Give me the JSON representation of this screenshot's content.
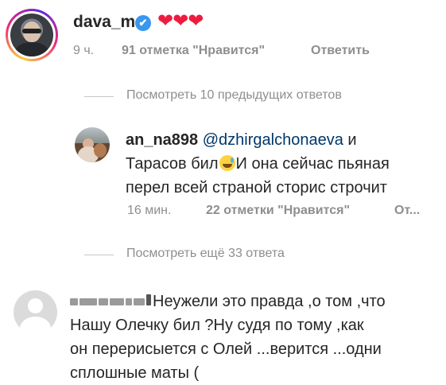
{
  "comment1": {
    "username": "dava_m",
    "verified_badge": "✔",
    "hearts": "❤❤❤",
    "time": "9 ч.",
    "likes": "91 отметка \"Нравится\"",
    "reply": "Ответить"
  },
  "view_previous": "Посмотреть 10 предыдущих ответов",
  "reply1": {
    "username": "an_na898",
    "mention": "@dzhirgalchonaeva",
    "text_after_mention": " и",
    "line2_before_emoji": "Тарасов бил",
    "emoji": "sweat-smile-emoji",
    "line2_after_emoji": "И она сейчас пьяная",
    "line3": "перел всей страной сторис строчит",
    "time": "16 мин.",
    "likes": "22 отметки \"Нравится\"",
    "reply": "От..."
  },
  "view_more": "Посмотреть ещё 33 ответа",
  "comment3": {
    "line1": "Неужели это правда ,о том ,что",
    "line2": "Нашу Олечку бил ?Ну судя по тому ,как",
    "line3": "он перерисыется с Олей ...верится ...одни",
    "line4": "сплошные маты ("
  },
  "colors": {
    "text": "#262626",
    "secondary": "#8e8e8e",
    "mention": "#00376b",
    "verified": "#3897f0",
    "hearts": "#ed1c3f"
  }
}
